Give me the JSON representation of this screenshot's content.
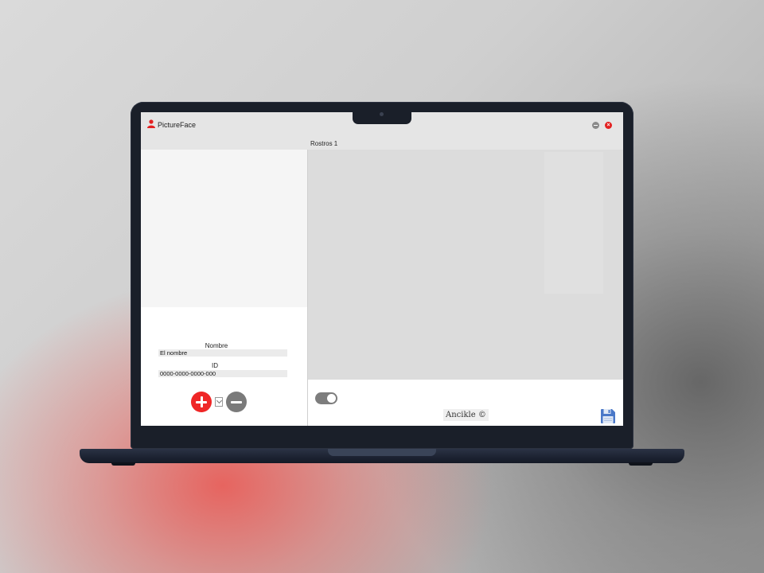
{
  "window": {
    "title": "PictureFace",
    "minimize_icon": "minimize-icon",
    "close_icon": "close-icon",
    "accent_color": "#ef2626"
  },
  "tabs": [
    {
      "label": "Rostros 1",
      "active": true
    }
  ],
  "form": {
    "nombre_label": "Nombre",
    "nombre_value": "El nombre",
    "id_label": "ID",
    "id_value": "0000-0000-0000-000"
  },
  "actions": {
    "add_icon": "plus-icon",
    "dropdown_icon": "chevron-down-icon",
    "remove_icon": "minus-icon"
  },
  "footer": {
    "credit": "Ancikle ©",
    "toggle_on": true,
    "save_icon": "save-icon",
    "save_color": "#4a78c8"
  }
}
